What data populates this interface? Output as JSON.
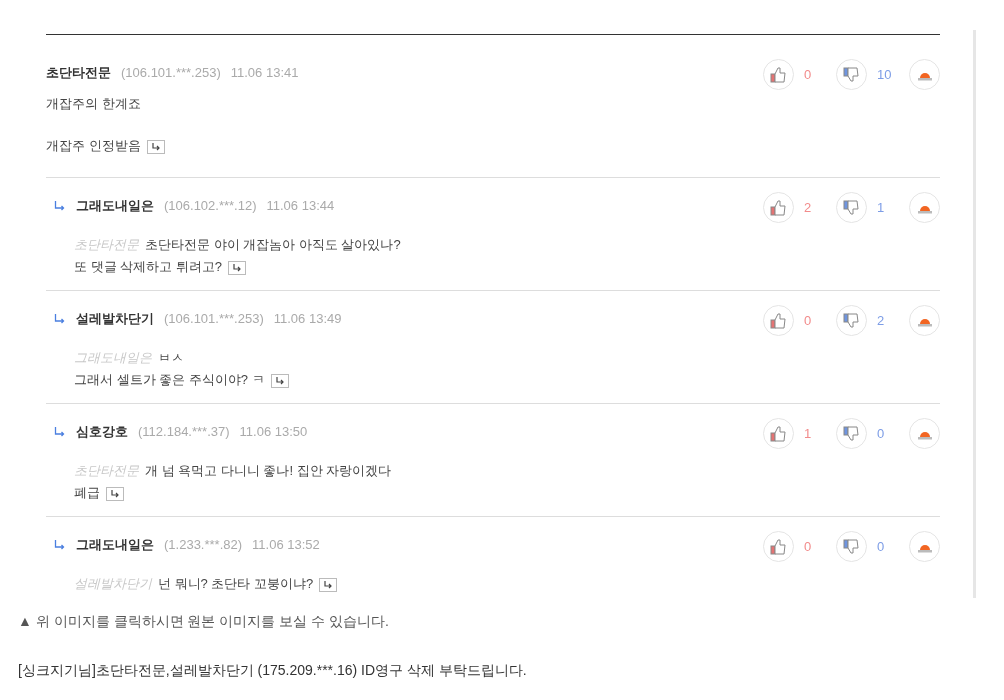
{
  "comments": [
    {
      "kind": "comment",
      "author": "초단타전문",
      "ip": "(106.101.***.253)",
      "time": "11.06 13:41",
      "paragraphs": [
        "개잡주의 한계죠",
        "개잡주 인정받음"
      ],
      "likes": "0",
      "dislikes": "10"
    },
    {
      "kind": "reply",
      "author": "그래도내일은",
      "ip": "(106.102.***.12)",
      "time": "11.06 13:44",
      "mention": "초단타전문",
      "paragraphs": [
        "초단타전문 야이 개잡놈아 아직도 살아있나?",
        "또 댓글 삭제하고 튀려고?"
      ],
      "likes": "2",
      "dislikes": "1"
    },
    {
      "kind": "reply",
      "author": "설레발차단기",
      "ip": "(106.101.***.253)",
      "time": "11.06 13:49",
      "mention": "그래도내일은",
      "paragraphs": [
        "ㅂㅅ",
        "그래서 셀트가 좋은 주식이야? ㅋ"
      ],
      "likes": "0",
      "dislikes": "2"
    },
    {
      "kind": "reply",
      "author": "심호강호",
      "ip": "(112.184.***.37)",
      "time": "11.06 13:50",
      "mention": "초단타전문",
      "paragraphs": [
        "개 넘 욕먹고 다니니 좋나! 집안 자랑이겠다",
        "폐급"
      ],
      "likes": "1",
      "dislikes": "0"
    },
    {
      "kind": "reply",
      "author": "그래도내일은",
      "ip": "(1.233.***.82)",
      "time": "11.06 13:52",
      "mention": "설레발차단기",
      "paragraphs": [
        "넌 뭐니? 초단타 꼬붕이냐?"
      ],
      "likes": "0",
      "dislikes": "0"
    }
  ],
  "caption": "▲ 위 이미지를 클릭하시면 원본 이미지를 보실 수 있습니다.",
  "request": "[싱크지기님]초단타전문,설레발차단기 (175.209.***.16) ID영구 삭제 부탁드립니다."
}
